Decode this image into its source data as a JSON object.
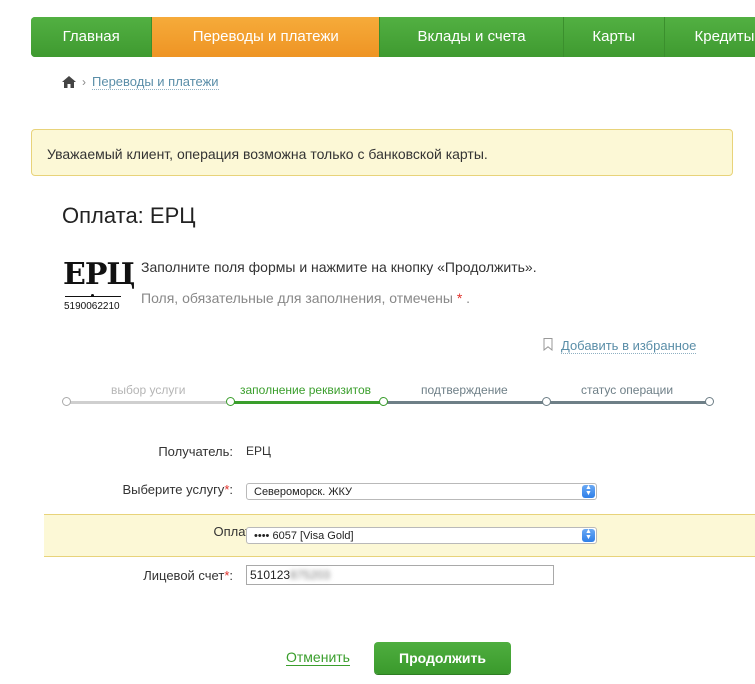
{
  "nav": {
    "items": [
      {
        "label": "Главная"
      },
      {
        "label": "Переводы и платежи"
      },
      {
        "label": "Вклады и счета"
      },
      {
        "label": "Карты"
      },
      {
        "label": "Кредиты"
      }
    ],
    "active_index": 1
  },
  "breadcrumb": {
    "current": "Переводы и платежи"
  },
  "alert": {
    "text": "Уважаемый клиент, операция возможна только с банковской карты."
  },
  "page": {
    "title": "Оплата: ЕРЦ"
  },
  "provider": {
    "logo_text": "ЕРЦ",
    "code": "5190062210"
  },
  "instructions": {
    "line1": "Заполните поля формы и нажмите на кнопку «Продолжить».",
    "line2": "Поля, обязательные для заполнения, отмечены",
    "required_mark": "*",
    "line2_end": "."
  },
  "favorite": {
    "label": "Добавить в избранное"
  },
  "steps": [
    {
      "label": "выбор услуги",
      "state": "done"
    },
    {
      "label": "заполнение реквизитов",
      "state": "current"
    },
    {
      "label": "подтверждение",
      "state": "pending"
    },
    {
      "label": "статус операции",
      "state": "pending"
    }
  ],
  "form": {
    "recipient_label": "Получатель:",
    "recipient_value": "ЕРЦ",
    "service_label": "Выберите услугу",
    "service_value": "Североморск. ЖКУ",
    "pay_from_label": "Оплата с",
    "pay_from_value": "•••• 6057 [Visa Gold]",
    "account_label": "Лицевой счет",
    "account_value_visible": "510123",
    "account_value_hidden": "875203",
    "required_mark": "*",
    "colon": ":"
  },
  "actions": {
    "cancel": "Отменить",
    "continue": "Продолжить"
  },
  "colors": {
    "green": "#3a9e2c",
    "orange": "#f29b2c",
    "highlight": "#fcf8d6",
    "link": "#5a8ea8"
  }
}
